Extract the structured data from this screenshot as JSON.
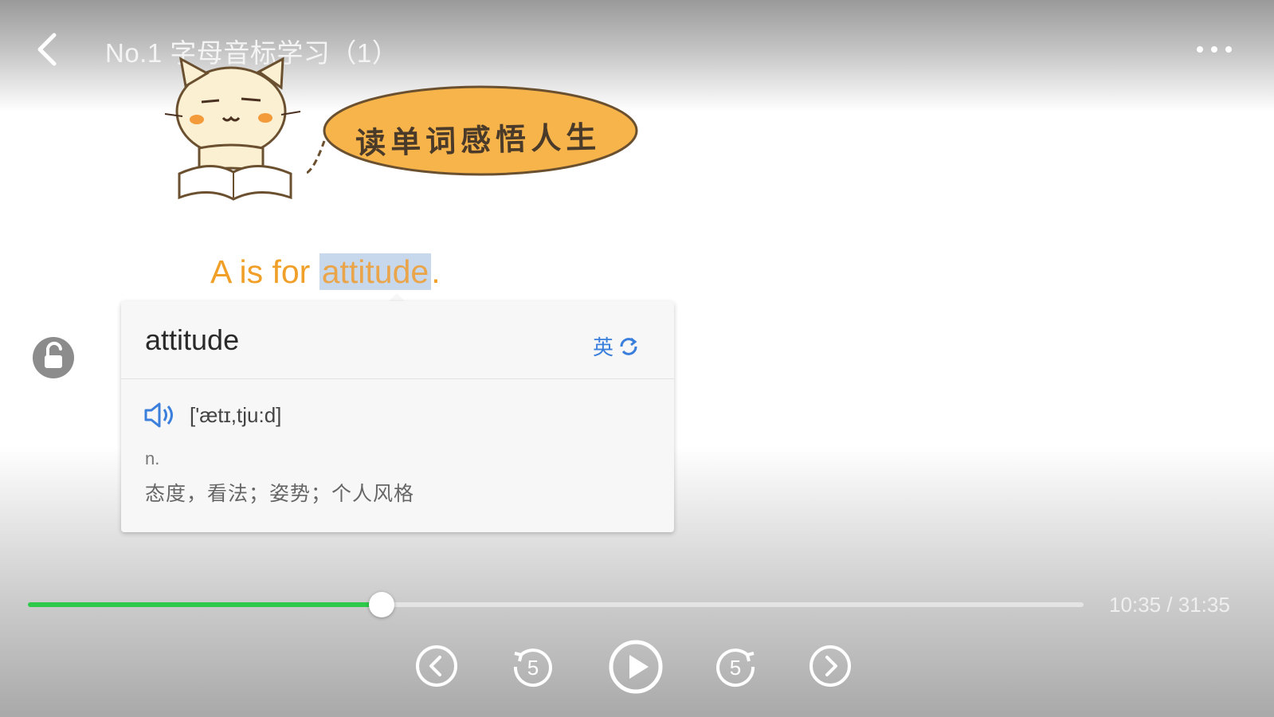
{
  "header": {
    "title": "No.1 字母音标学习（1）",
    "back_icon": "chevron-left-icon",
    "more_icon": "more-horizontal-icon"
  },
  "illustration": {
    "bubble_text": "读单词感悟人生",
    "mascot": "cat-reading-book"
  },
  "subtitle": {
    "before": "A is for ",
    "highlight": "attitude",
    "after": "."
  },
  "dictionary": {
    "word": "attitude",
    "lang_label": "英",
    "lang_icon": "switch-icon",
    "phonetic": "['ætɪ,tju:d]",
    "speaker_icon": "speaker-icon",
    "part_of_speech": "n.",
    "definition": "态度，看法；姿势；个人风格"
  },
  "lock": {
    "icon": "lock-open-icon"
  },
  "player": {
    "current_time": "10:35",
    "total_time": "31:35",
    "time_separator": " / ",
    "progress": 0.335,
    "accent_color": "#2ec84a",
    "controls": [
      "previous-icon",
      "rewind-5-icon",
      "play-icon",
      "forward-5-icon",
      "next-icon"
    ],
    "rewind_label": "5",
    "forward_label": "5"
  }
}
